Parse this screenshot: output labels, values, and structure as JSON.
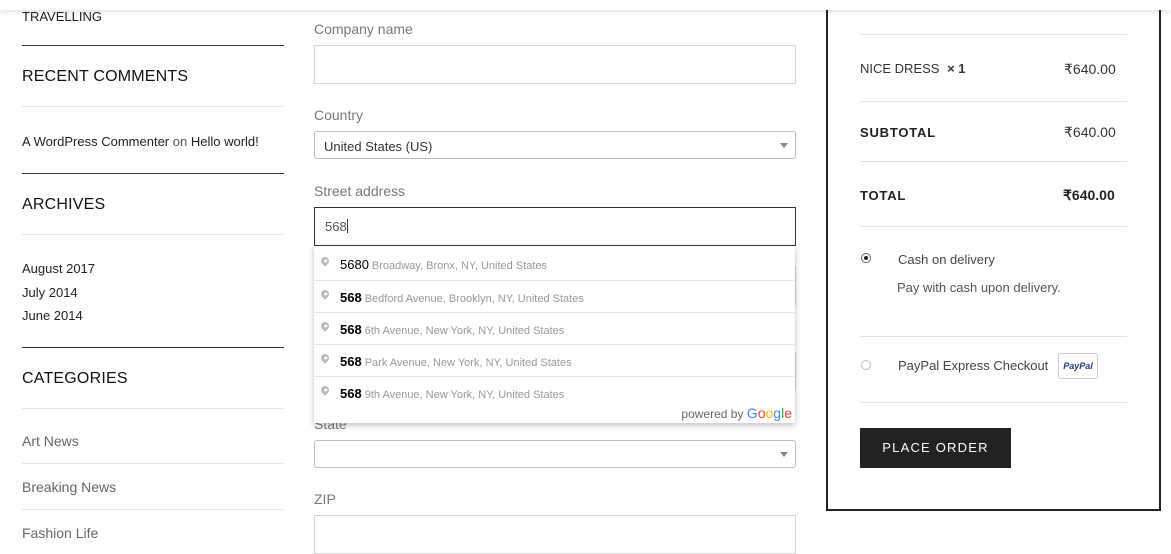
{
  "sidebar": {
    "travelling": "TRAVELLING",
    "recent_comments_title": "RECENT COMMENTS",
    "comment": {
      "author": "A WordPress Commenter",
      "on": "on",
      "post": "Hello world!"
    },
    "archives_title": "ARCHIVES",
    "archives": [
      "August 2017",
      "July 2014",
      "June 2014"
    ],
    "categories_title": "CATEGORIES",
    "categories": [
      "Art News",
      "Breaking News",
      "Fashion Life"
    ]
  },
  "form": {
    "company_label": "Company name",
    "country_label": "Country",
    "country_value": "United States (US)",
    "street_label": "Street address",
    "street_value": "568",
    "state_label": "State",
    "zip_label": "ZIP"
  },
  "autocomplete": {
    "items": [
      {
        "main": "5680",
        "rest": "Broadway, Bronx, NY, United States"
      },
      {
        "main": "568",
        "rest": "Bedford Avenue, Brooklyn, NY, United States"
      },
      {
        "main": "568",
        "rest": "6th Avenue, New York, NY, United States"
      },
      {
        "main": "568",
        "rest": "Park Avenue, New York, NY, United States"
      },
      {
        "main": "568",
        "rest": "9th Avenue, New York, NY, United States"
      }
    ],
    "powered_by": "powered by",
    "google": [
      "G",
      "o",
      "o",
      "g",
      "l",
      "e"
    ]
  },
  "order": {
    "item_name": "NICE DRESS",
    "item_qty": "× 1",
    "item_price": "₹640.00",
    "subtotal_label": "SUBTOTAL",
    "subtotal_value": "₹640.00",
    "total_label": "TOTAL",
    "total_value": "₹640.00",
    "payment": {
      "cod_label": "Cash on delivery",
      "cod_desc": "Pay with cash upon delivery.",
      "paypal_label": "PayPal Express Checkout",
      "paypal_logo": "PayPal"
    },
    "place_order": "PLACE ORDER"
  },
  "colors": {
    "accent": "#222222",
    "google_blue": "#4285f4",
    "google_red": "#ea4335",
    "google_yellow": "#fbbc05",
    "google_green": "#34a853"
  }
}
